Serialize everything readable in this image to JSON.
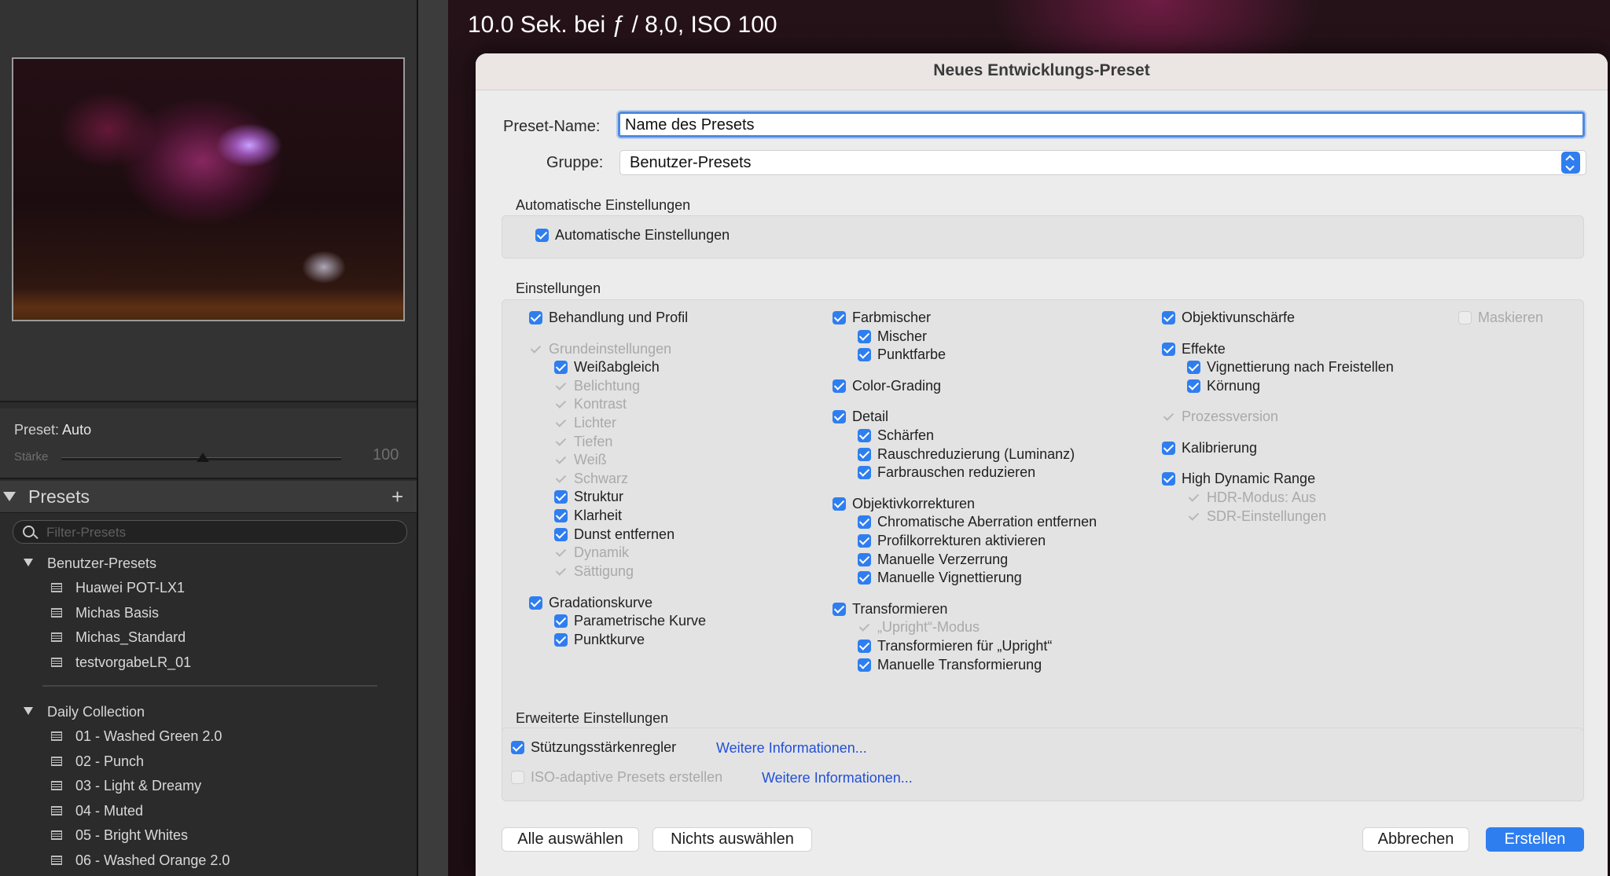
{
  "left_panel": {
    "preset_label": "Preset:",
    "preset_value": "Auto",
    "strength_label": "Stärke",
    "strength_value": "100",
    "presets_title": "Presets",
    "add_symbol": "+",
    "filter_placeholder": "Filter-Presets",
    "groups": [
      {
        "title": "Benutzer-Presets",
        "items": [
          "Huawei POT-LX1",
          "Michas Basis",
          "Michas_Standard",
          "testvorgabeLR_01"
        ]
      },
      {
        "title": "Daily Collection",
        "items": [
          "01 - Washed Green 2.0",
          "02 - Punch",
          "03 - Light & Dreamy",
          "04 - Muted",
          "05 - Bright Whites",
          "06 - Washed Orange 2.0"
        ]
      }
    ]
  },
  "photo_overlay": {
    "line1": "10.0 Sek. bei ƒ / 8,0, ISO 100"
  },
  "dialog": {
    "title": "Neues Entwicklungs-Preset",
    "name_label": "Preset-Name:",
    "name_value": "Name des Presets",
    "group_label": "Gruppe:",
    "group_value": "Benutzer-Presets",
    "auto_section": {
      "title": "Automatische Einstellungen",
      "checkbox": "Automatische Einstellungen"
    },
    "settings_section_title": "Einstellungen",
    "col1": {
      "behandlung": "Behandlung und Profil",
      "grund": "Grundeinstellungen",
      "weissabgleich": "Weißabgleich",
      "belichtung": "Belichtung",
      "kontrast": "Kontrast",
      "lichter": "Lichter",
      "tiefen": "Tiefen",
      "weiss": "Weiß",
      "schwarz": "Schwarz",
      "struktur": "Struktur",
      "klarheit": "Klarheit",
      "dunst": "Dunst entfernen",
      "dynamik": "Dynamik",
      "saettigung": "Sättigung",
      "gradation": "Gradationskurve",
      "parametrisch": "Parametrische Kurve",
      "punktkurve": "Punktkurve"
    },
    "col2": {
      "farbmischer": "Farbmischer",
      "mischer": "Mischer",
      "punktfarbe": "Punktfarbe",
      "color_grading": "Color-Grading",
      "detail": "Detail",
      "schaerfen": "Schärfen",
      "rausch_lum": "Rauschreduzierung (Luminanz)",
      "farbrauschen": "Farbrauschen reduzieren",
      "objektivkorr": "Objektivkorrekturen",
      "chrom": "Chromatische Aberration entfernen",
      "profilkorr": "Profilkorrekturen aktivieren",
      "verzerrung": "Manuelle Verzerrung",
      "vignettierung": "Manuelle Vignettierung",
      "transformieren": "Transformieren",
      "upright_modus": "„Upright“-Modus",
      "transform_upright": "Transformieren für „Upright“",
      "manuelle_transform": "Manuelle Transformierung"
    },
    "col3": {
      "objektivunschaerfe": "Objektivunschärfe",
      "effekte": "Effekte",
      "vignettierung_frei": "Vignettierung nach Freistellen",
      "koernung": "Körnung",
      "prozessversion": "Prozessversion",
      "kalibrierung": "Kalibrierung",
      "hdr": "High Dynamic Range",
      "hdr_modus": "HDR-Modus: Aus",
      "sdr": "SDR-Einstellungen"
    },
    "col4": {
      "maskieren": "Maskieren"
    },
    "advanced_section": {
      "title": "Erweiterte Einstellungen",
      "stuetz": "Stützungsstärkenregler",
      "iso": "ISO-adaptive Presets erstellen",
      "link1": "Weitere Informationen...",
      "link2": "Weitere Informationen..."
    },
    "buttons": {
      "select_all": "Alle auswählen",
      "select_none": "Nichts auswählen",
      "cancel": "Abbrechen",
      "create": "Erstellen"
    }
  },
  "colors": {
    "accent": "#2f7ef0",
    "link": "#2350d8",
    "panel_bg": "#2b2b2b",
    "dialog_bg": "#ececec"
  }
}
